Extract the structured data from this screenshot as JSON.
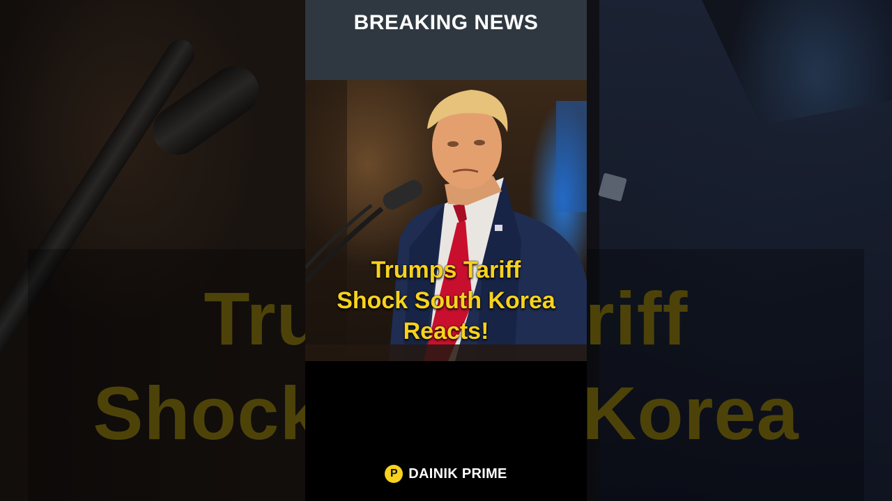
{
  "header": {
    "title": "BREAKING NEWS"
  },
  "headline": {
    "lines": [
      "Trumps Tariff",
      "Shock South Korea",
      "Reacts!"
    ]
  },
  "background_headline": {
    "lines": [
      "Trumps Tariff",
      "Shock South Korea"
    ]
  },
  "brand": {
    "logo_letter": "P",
    "name": "DAINIK PRIME"
  },
  "colors": {
    "header_bg": "#2f3840",
    "headline_yellow": "#f7d21e",
    "tie_red": "#c8102e",
    "suit_navy": "#1f2d52"
  }
}
